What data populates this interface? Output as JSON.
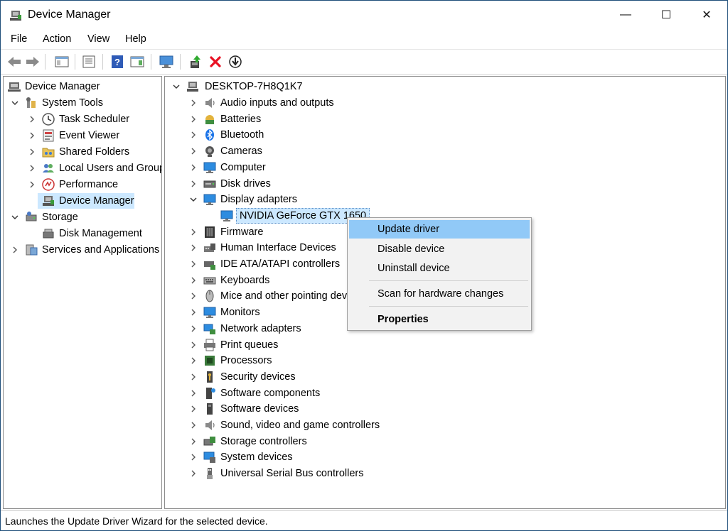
{
  "window": {
    "title": "Device Manager"
  },
  "window_controls": {
    "minimize": "—",
    "maximize": "☐",
    "close": "✕"
  },
  "menu": [
    "File",
    "Action",
    "View",
    "Help"
  ],
  "left_tree": {
    "root": "Device Manager",
    "system_tools": "System Tools",
    "task_scheduler": "Task Scheduler",
    "event_viewer": "Event Viewer",
    "shared_folders": "Shared Folders",
    "local_users": "Local Users and Groups",
    "performance": "Performance",
    "device_manager": "Device Manager",
    "storage": "Storage",
    "disk_management": "Disk Management",
    "services": "Services and Applications"
  },
  "right_tree": {
    "computer_name": "DESKTOP-7H8Q1K7",
    "categories": [
      "Audio inputs and outputs",
      "Batteries",
      "Bluetooth",
      "Cameras",
      "Computer",
      "Disk drives",
      "Display adapters",
      "NVIDIA GeForce GTX 1650",
      "Firmware",
      "Human Interface Devices",
      "IDE ATA/ATAPI controllers",
      "Keyboards",
      "Mice and other pointing devices",
      "Monitors",
      "Network adapters",
      "Print queues",
      "Processors",
      "Security devices",
      "Software components",
      "Software devices",
      "Sound, video and game controllers",
      "Storage controllers",
      "System devices",
      "Universal Serial Bus controllers"
    ]
  },
  "context_menu": {
    "update_driver": "Update driver",
    "disable_device": "Disable device",
    "uninstall_device": "Uninstall device",
    "scan_hardware": "Scan for hardware changes",
    "properties": "Properties"
  },
  "status": {
    "text": "Launches the Update Driver Wizard for the selected device."
  },
  "colors": {
    "selection": "#cce8ff",
    "menu_highlight": "#91c9f7",
    "delete_red": "#e81123"
  }
}
